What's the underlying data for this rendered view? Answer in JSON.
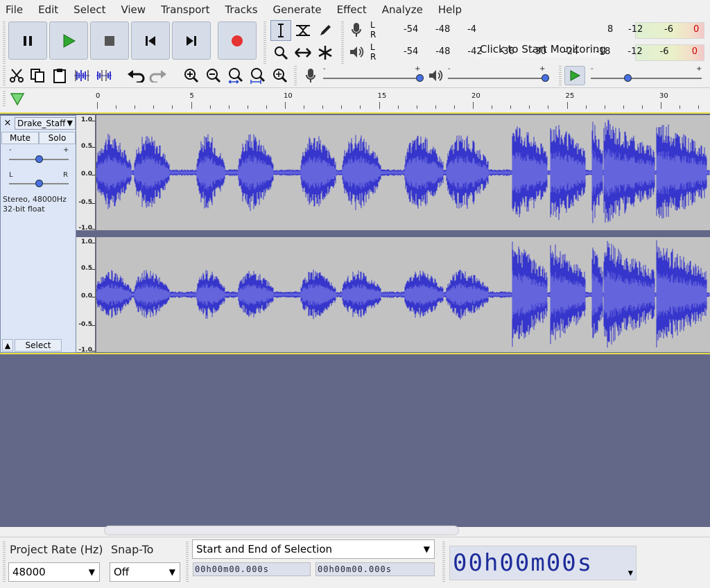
{
  "menu": [
    "File",
    "Edit",
    "Select",
    "View",
    "Transport",
    "Tracks",
    "Generate",
    "Effect",
    "Analyze",
    "Help"
  ],
  "meters": {
    "record_ticks": [
      "-54",
      "-48",
      "-4"
    ],
    "record_tail_ticks": [
      "8",
      "-12",
      "-6",
      "0"
    ],
    "playback_ticks": [
      "-54",
      "-48",
      "-42",
      "-36",
      "-30",
      "-24",
      "-18",
      "-12",
      "-6",
      "0"
    ],
    "monitor_tip": "Click to Start Monitoring",
    "channel_l": "L",
    "channel_r": "R"
  },
  "sliders": {
    "minus": "-",
    "plus": "+"
  },
  "ruler": {
    "labels": [
      "0",
      "5",
      "10",
      "15",
      "20",
      "25",
      "30"
    ]
  },
  "track": {
    "close": "×",
    "name": "Drake_Staff",
    "mute": "Mute",
    "solo": "Solo",
    "gain_minus": "-",
    "gain_plus": "+",
    "pan_l": "L",
    "pan_r": "R",
    "info_line1": "Stereo, 48000Hz",
    "info_line2": "32-bit float",
    "select": "Select",
    "vruler_labels": [
      "1.0",
      "0.5",
      "0.0",
      "-0.5",
      "-1.0"
    ]
  },
  "bottom": {
    "project_rate_label": "Project Rate (Hz)",
    "project_rate_value": "48000",
    "snap_to_label": "Snap-To",
    "snap_to_value": "Off",
    "selection_mode": "Start and End of Selection",
    "sel_start": "00h00m00.000s",
    "sel_end": "00h00m00.000s",
    "audio_position": "00h00m00s"
  },
  "colors": {
    "waveform": "#3636cc",
    "waveform_rms": "#6464dc",
    "wave_bg": "#c2c2c2",
    "track_bg": "#646888",
    "record": "#e63333",
    "play": "#2fa82f"
  }
}
